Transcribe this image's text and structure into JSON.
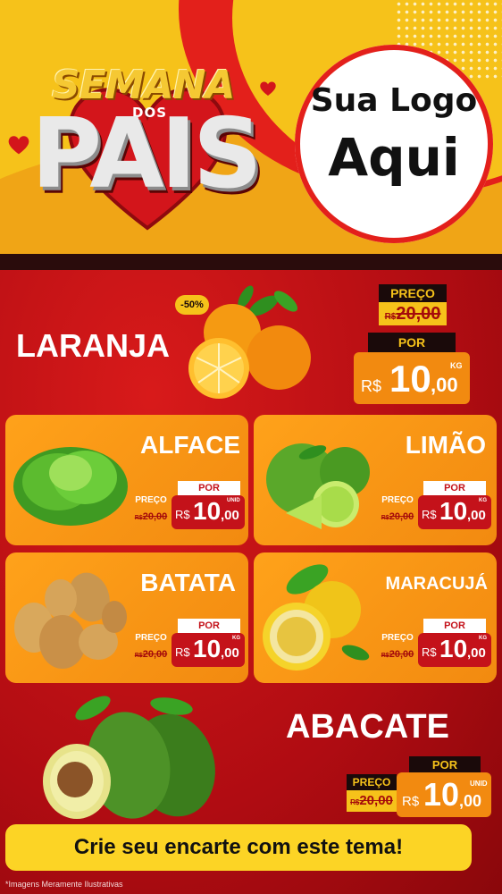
{
  "header": {
    "title_semana": "SEMANA",
    "title_dos": "DOS",
    "title_pais": "PAIS",
    "logo_line1": "Sua Logo",
    "logo_line2": "Aqui"
  },
  "featured": {
    "name": "LARANJA",
    "discount_badge": "-50%",
    "preco_label": "PREÇO",
    "old_currency": "R$",
    "old_price": "20,00",
    "por_label": "POR",
    "new_currency": "R$",
    "new_int": "10",
    "new_cents": ",00",
    "unit": "KG"
  },
  "cards": [
    {
      "name": "ALFACE",
      "preco_label": "PREÇO",
      "old_currency": "R$",
      "old_price": "20,00",
      "por_label": "POR",
      "new_currency": "R$",
      "new_int": "10",
      "new_cents": ",00",
      "unit": "UNID"
    },
    {
      "name": "LIMÃO",
      "preco_label": "PREÇO",
      "old_currency": "R$",
      "old_price": "20,00",
      "por_label": "POR",
      "new_currency": "R$",
      "new_int": "10",
      "new_cents": ",00",
      "unit": "KG"
    },
    {
      "name": "BATATA",
      "preco_label": "PREÇO",
      "old_currency": "R$",
      "old_price": "20,00",
      "por_label": "POR",
      "new_currency": "R$",
      "new_int": "10",
      "new_cents": ",00",
      "unit": "KG"
    },
    {
      "name": "MARACUJÁ",
      "preco_label": "PREÇO",
      "old_currency": "R$",
      "old_price": "20,00",
      "por_label": "POR",
      "new_currency": "R$",
      "new_int": "10",
      "new_cents": ",00",
      "unit": "KG"
    }
  ],
  "bottom": {
    "name": "ABACATE",
    "preco_label": "PREÇO",
    "old_currency": "R$",
    "old_price": "20,00",
    "por_label": "POR",
    "new_currency": "R$",
    "new_int": "10",
    "new_cents": ",00",
    "unit": "UNID"
  },
  "footer": {
    "cta": "Crie seu encarte com este tema!",
    "disclaimer": "*Imagens Meramente Ilustrativas"
  },
  "icons": [
    "heart-icon",
    "orange-fruit-icon",
    "lettuce-icon",
    "lime-icon",
    "potato-icon",
    "passion-fruit-icon",
    "avocado-icon"
  ],
  "colors": {
    "red": "#c4121a",
    "yellow": "#f6c21a",
    "orange": "#f28a10",
    "dark": "#1a0a0a"
  }
}
